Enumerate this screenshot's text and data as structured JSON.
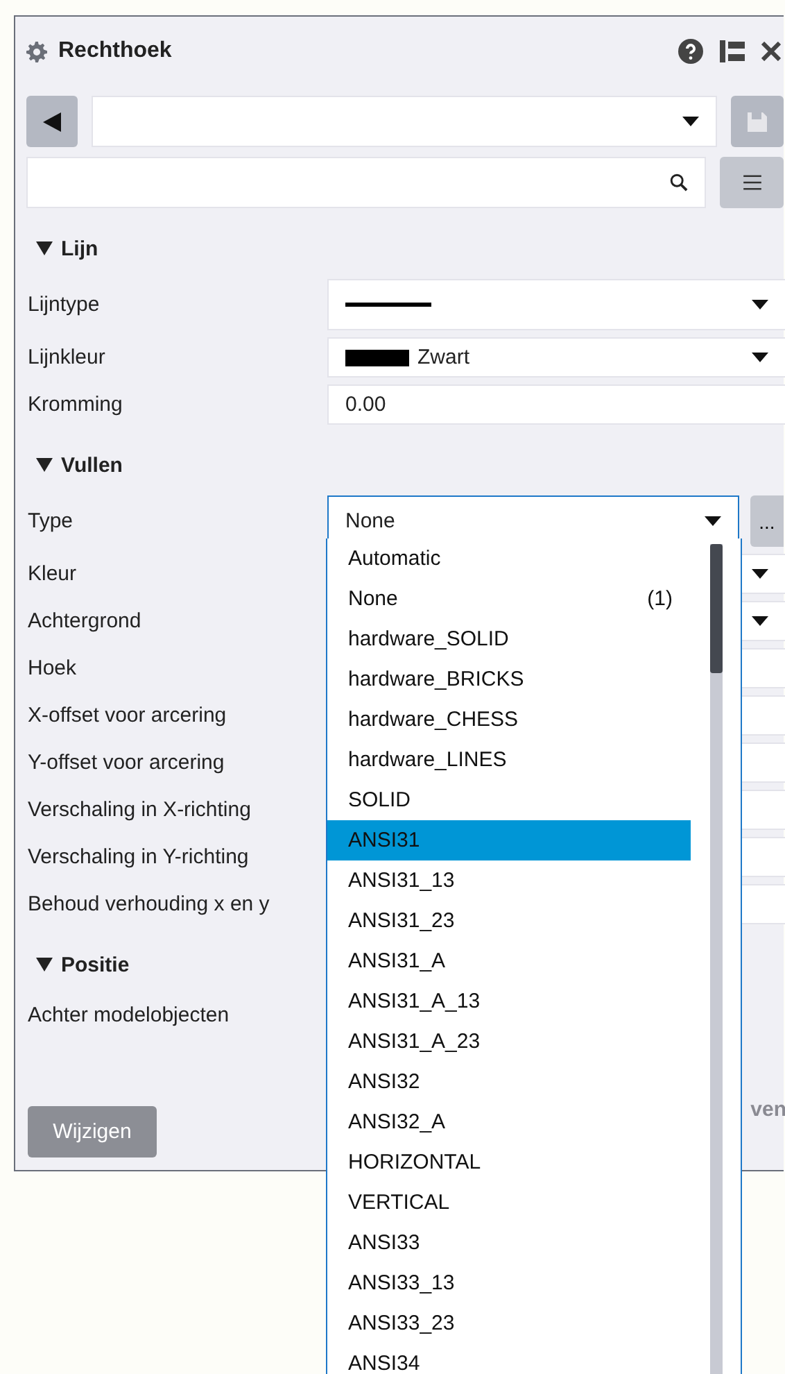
{
  "panel": {
    "title": "Rechthoek"
  },
  "sections": [
    {
      "title": "Lijn",
      "expanded": true,
      "rows": [
        {
          "label": "Lijntype",
          "kind": "linestyle"
        },
        {
          "label": "Lijnkleur",
          "kind": "color",
          "value": "Zwart"
        },
        {
          "label": "Kromming",
          "kind": "number",
          "value": "0.00"
        }
      ]
    },
    {
      "title": "Vullen",
      "expanded": true,
      "rows": [
        {
          "label": "Type",
          "kind": "open-select",
          "value": "None",
          "more": "..."
        },
        {
          "label": "Kleur",
          "kind": "select"
        },
        {
          "label": "Achtergrond",
          "kind": "select"
        },
        {
          "label": "Hoek",
          "kind": "number"
        },
        {
          "label": "X-offset voor arcering",
          "kind": "number"
        },
        {
          "label": "Y-offset voor arcering",
          "kind": "number"
        },
        {
          "label": "Verschaling in X-richting",
          "kind": "number"
        },
        {
          "label": "Verschaling in Y-richting",
          "kind": "number"
        },
        {
          "label": "Behoud verhouding x en y",
          "kind": "number"
        }
      ]
    },
    {
      "title": "Positie",
      "expanded": true,
      "rows": [
        {
          "label": "Achter modelobjecten",
          "kind": "hidden"
        }
      ]
    }
  ],
  "fragment": "ven",
  "apply_button": {
    "label": "Wijzigen",
    "disabled": true
  },
  "dropdown": {
    "items": [
      {
        "label": "Automatic",
        "selected": false
      },
      {
        "label": "None",
        "count": "(1)",
        "selected": false
      },
      {
        "label": "hardware_SOLID",
        "selected": false
      },
      {
        "label": "hardware_BRICKS",
        "selected": false
      },
      {
        "label": "hardware_CHESS",
        "selected": false
      },
      {
        "label": "hardware_LINES",
        "selected": false
      },
      {
        "label": "SOLID",
        "selected": false
      },
      {
        "label": "ANSI31",
        "selected": true
      },
      {
        "label": "ANSI31_13",
        "selected": false
      },
      {
        "label": "ANSI31_23",
        "selected": false
      },
      {
        "label": "ANSI31_A",
        "selected": false
      },
      {
        "label": "ANSI31_A_13",
        "selected": false
      },
      {
        "label": "ANSI31_A_23",
        "selected": false
      },
      {
        "label": "ANSI32",
        "selected": false
      },
      {
        "label": "ANSI32_A",
        "selected": false
      },
      {
        "label": "HORIZONTAL",
        "selected": false
      },
      {
        "label": "VERTICAL",
        "selected": false
      },
      {
        "label": "ANSI33",
        "selected": false
      },
      {
        "label": "ANSI33_13",
        "selected": false
      },
      {
        "label": "ANSI33_23",
        "selected": false
      },
      {
        "label": "ANSI34",
        "selected": false
      }
    ]
  }
}
